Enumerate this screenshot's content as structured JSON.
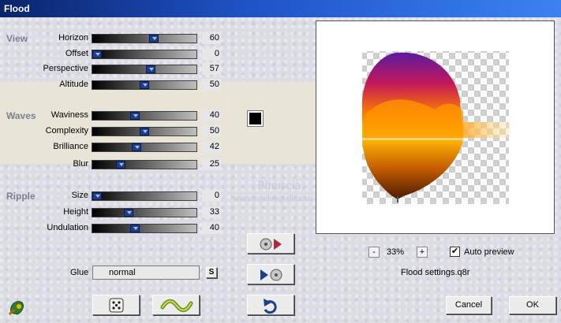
{
  "window": {
    "title": "Flood"
  },
  "sections": {
    "view": "View",
    "waves": "Waves",
    "ripple": "Ripple"
  },
  "sliders": {
    "horizon": {
      "label": "Horizon",
      "value": "60",
      "level": 0.6
    },
    "offset": {
      "label": "Offset",
      "value": "0",
      "level": 0.0
    },
    "perspective": {
      "label": "Perspective",
      "value": "57",
      "level": 0.57
    },
    "altitude": {
      "label": "Altitude",
      "value": "50",
      "level": 0.5
    },
    "waviness": {
      "label": "Waviness",
      "value": "40",
      "level": 0.4
    },
    "complexity": {
      "label": "Complexity",
      "value": "50",
      "level": 0.5
    },
    "brilliance": {
      "label": "Brilliance",
      "value": "42",
      "level": 0.42
    },
    "blur": {
      "label": "Blur",
      "value": "25",
      "level": 0.25
    },
    "size": {
      "label": "Size",
      "value": "0",
      "level": 0.0
    },
    "height": {
      "label": "Height",
      "value": "33",
      "level": 0.33
    },
    "undulation": {
      "label": "Undulation",
      "value": "40",
      "level": 0.4
    }
  },
  "colors": {
    "wave_swatch": "#000000",
    "section_label": "#7a7f92",
    "thumb": "#1e3d8c"
  },
  "glue": {
    "label": "Glue",
    "value": "normal",
    "s_button": "S"
  },
  "preview": {
    "zoom": "33%",
    "zoom_minus": "-",
    "zoom_plus": "+",
    "auto_preview_label": "Auto preview",
    "auto_preview_checked": "✔"
  },
  "settings_file": "Flood settings.q8r",
  "watermark": {
    "name": "Pinuccia",
    "url": "www.maidiregrafica.eu"
  },
  "buttons": {
    "cancel": "Cancel",
    "ok": "OK"
  },
  "icons": {
    "app": "plugin-logo-icon",
    "randomize": "dice-icon",
    "reset": "wave-icon",
    "undo": "undo-icon",
    "load_preset": "load-preset-icon",
    "save_preset": "save-preset-icon"
  }
}
